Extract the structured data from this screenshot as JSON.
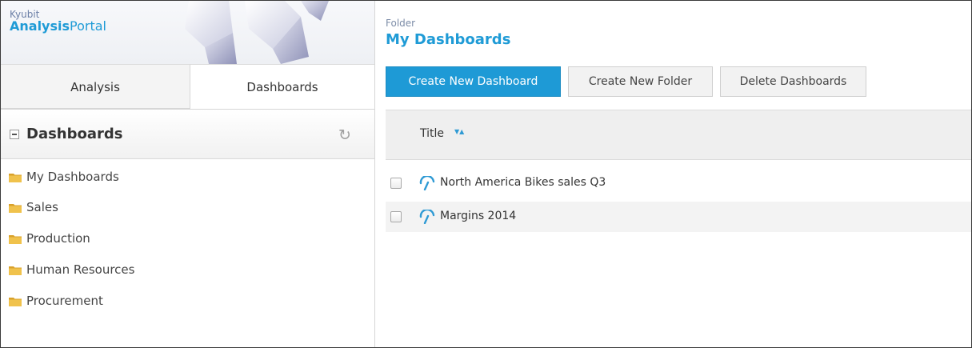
{
  "brand": {
    "small": "Kyubit",
    "name_bold": "Analysis",
    "name_rest": "Portal"
  },
  "tabs": [
    {
      "label": "Analysis",
      "active": false
    },
    {
      "label": "Dashboards",
      "active": true
    }
  ],
  "sidebar": {
    "section_title": "Dashboards",
    "folders": [
      {
        "label": "My Dashboards",
        "icon": "folder-icon"
      },
      {
        "label": "Sales",
        "icon": "folder-icon"
      },
      {
        "label": "Production",
        "icon": "folder-icon"
      },
      {
        "label": "Human Resources",
        "icon": "folder-icon"
      },
      {
        "label": "Procurement",
        "icon": "folder-icon"
      }
    ]
  },
  "main": {
    "breadcrumb_label": "Folder",
    "folder_title": "My Dashboards",
    "toolbar": {
      "create_dashboard": "Create New Dashboard",
      "create_folder": "Create New Folder",
      "delete_dashboards": "Delete Dashboards"
    },
    "table": {
      "column_title": "Title",
      "rows": [
        {
          "title": "North America Bikes sales Q3",
          "icon": "dashboard-gauge-icon",
          "checked": false
        },
        {
          "title": "Margins 2014",
          "icon": "dashboard-gauge-icon",
          "checked": false
        }
      ]
    }
  },
  "colors": {
    "accent": "#1e9ad6",
    "folder": "#e8b33a"
  }
}
